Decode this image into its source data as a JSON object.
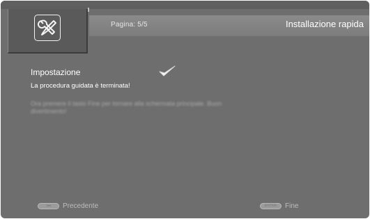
{
  "header": {
    "page_label": "Pagina: 5/5",
    "title": "Installazione rapida"
  },
  "content": {
    "section_title": "Impostazione",
    "message": "La procedura guidata è terminata!",
    "blurred_message": "Ora premere il tasto Fine per tornare alla schermata principale. Buon divertimento!"
  },
  "footer": {
    "prev_key": "|◂◂",
    "prev_label": "Precedente",
    "next_key": "ENTER",
    "next_label": "Fine"
  },
  "icons": {
    "setup": "wrench-screwdriver-icon",
    "done": "checkmark-icon"
  },
  "colors": {
    "background": "#6e6e6e",
    "header_strip": "#858585",
    "text": "#ffffff",
    "muted_text": "#bdbdbd"
  }
}
